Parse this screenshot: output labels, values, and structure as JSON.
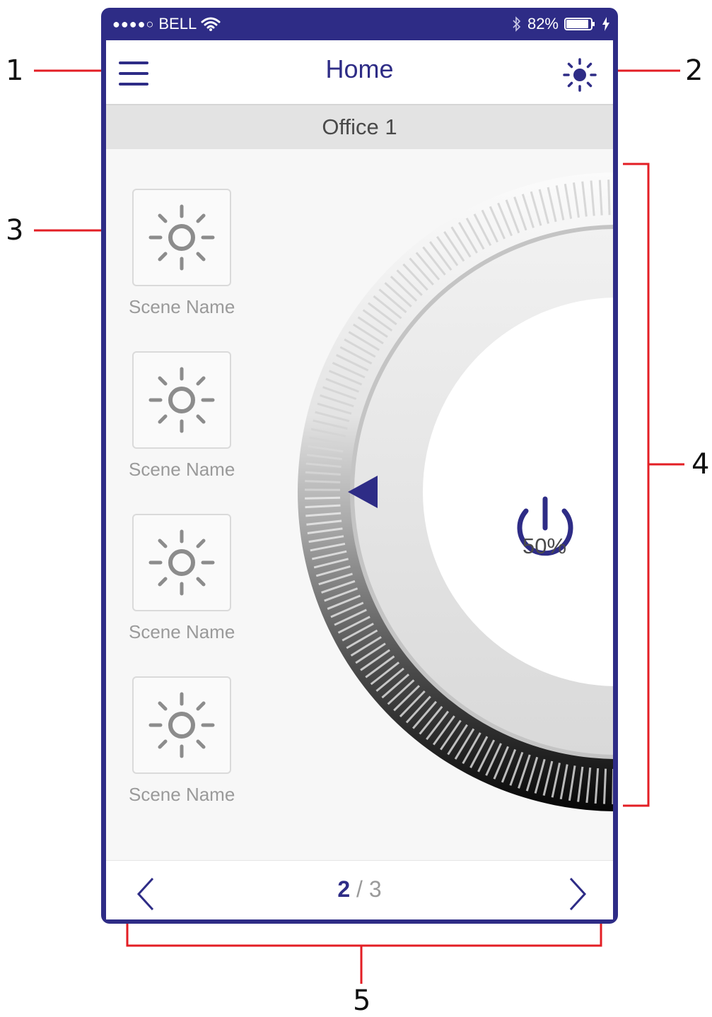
{
  "status_bar": {
    "carrier": "BELL",
    "signal_dots": "●●●●○",
    "battery": "82%"
  },
  "header": {
    "title": "Home"
  },
  "location": {
    "name": "Office 1"
  },
  "scenes": [
    {
      "label": "Scene Name"
    },
    {
      "label": "Scene Name"
    },
    {
      "label": "Scene Name"
    },
    {
      "label": "Scene Name"
    }
  ],
  "dimmer": {
    "level_text": "50%",
    "level": 0.5
  },
  "pagination": {
    "current": "2",
    "separator": " / ",
    "total": "3"
  },
  "callouts": [
    "1",
    "2",
    "3",
    "4",
    "5"
  ],
  "colors": {
    "accent": "#2e2c86",
    "callout_line": "#e31e24",
    "scene_icon": "#8c8c8c"
  },
  "icons": {
    "menu": "hamburger-icon",
    "brightness": "sun-filled-icon",
    "scene": "sun-outline-icon",
    "power": "power-icon",
    "prev": "chevron-left-icon",
    "next": "chevron-right-icon",
    "wifi": "wifi-icon",
    "bluetooth": "bluetooth-icon",
    "battery": "battery-icon",
    "charging": "bolt-icon"
  }
}
